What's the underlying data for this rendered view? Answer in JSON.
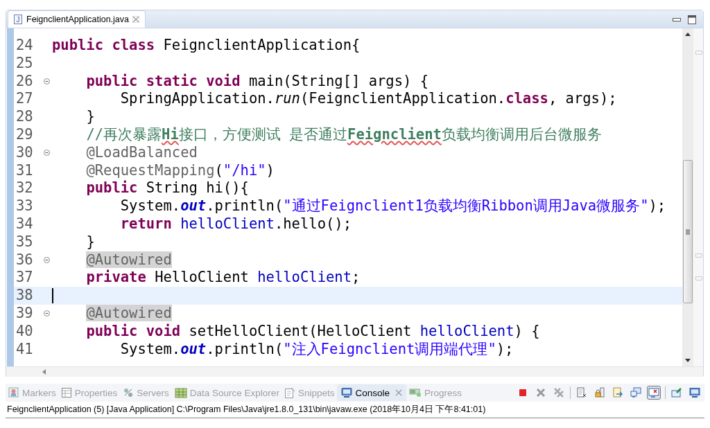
{
  "editor": {
    "tab": {
      "icon_text": "J",
      "title": "FeignclientApplication.java",
      "selected": true
    },
    "lines": [
      {
        "number": "24",
        "fold_marker": false,
        "current": false,
        "tokens": [
          {
            "kind": "kw",
            "text": "public class"
          },
          {
            "kind": "plain",
            "text": " FeignclientApplication{"
          }
        ]
      },
      {
        "number": "25",
        "fold_marker": false,
        "current": false
      },
      {
        "number": "26",
        "fold_marker": true,
        "current": false,
        "tokens": [
          {
            "kind": "kw",
            "text": "    public static void"
          },
          {
            "kind": "plain",
            "text": " main(String[] args) {"
          }
        ]
      },
      {
        "number": "27",
        "fold_marker": false,
        "current": false,
        "tokens": [
          {
            "kind": "plain",
            "text": "        SpringApplication."
          },
          {
            "kind": "static-method",
            "text": "run"
          },
          {
            "kind": "plain",
            "text": "(FeignclientApplication."
          },
          {
            "kind": "kw",
            "text": "class"
          },
          {
            "kind": "plain",
            "text": ", args);"
          }
        ]
      },
      {
        "number": "28",
        "fold_marker": false,
        "current": false,
        "tokens": [
          {
            "kind": "plain",
            "text": "    }"
          }
        ]
      },
      {
        "number": "29",
        "fold_marker": false,
        "current": false,
        "tokens": [
          {
            "kind": "comment",
            "text": "    //再次暴露"
          },
          {
            "kind": "comment-flagged",
            "text": "Hi"
          },
          {
            "kind": "comment",
            "text": "接口，方便测试 是否通过"
          },
          {
            "kind": "comment-flagged",
            "text": "Feignclient"
          },
          {
            "kind": "comment",
            "text": "负载均衡调用后台微服务"
          }
        ]
      },
      {
        "number": "30",
        "fold_marker": true,
        "current": false,
        "tokens": [
          {
            "kind": "ann",
            "text": "    @LoadBalanced"
          }
        ]
      },
      {
        "number": "31",
        "fold_marker": false,
        "current": false,
        "tokens": [
          {
            "kind": "ann",
            "text": "    @RequestMapping"
          },
          {
            "kind": "plain",
            "text": "("
          },
          {
            "kind": "str",
            "text": "\"/hi\""
          },
          {
            "kind": "plain",
            "text": ")"
          }
        ]
      },
      {
        "number": "32",
        "fold_marker": false,
        "current": false,
        "tokens": [
          {
            "kind": "kw",
            "text": "    public"
          },
          {
            "kind": "plain",
            "text": " String hi(){"
          }
        ]
      },
      {
        "number": "33",
        "fold_marker": false,
        "current": false,
        "tokens": [
          {
            "kind": "plain",
            "text": "        System."
          },
          {
            "kind": "static-field",
            "text": "out"
          },
          {
            "kind": "plain",
            "text": ".println("
          },
          {
            "kind": "str",
            "text": "\"通过Feignclient1负载均衡Ribbon调用Java微服务\""
          },
          {
            "kind": "plain",
            "text": ");"
          }
        ]
      },
      {
        "number": "34",
        "fold_marker": false,
        "current": false,
        "tokens": [
          {
            "kind": "kw",
            "text": "        return "
          },
          {
            "kind": "field",
            "text": "helloClient"
          },
          {
            "kind": "plain",
            "text": ".hello();"
          }
        ]
      },
      {
        "number": "35",
        "fold_marker": false,
        "current": false,
        "tokens": [
          {
            "kind": "plain",
            "text": "    }"
          }
        ]
      },
      {
        "number": "36",
        "fold_marker": true,
        "current": false,
        "tokens": [
          {
            "kind": "ann-marked",
            "text": "    @Autowired"
          }
        ]
      },
      {
        "number": "37",
        "fold_marker": false,
        "current": false,
        "tokens": [
          {
            "kind": "kw",
            "text": "    private"
          },
          {
            "kind": "plain",
            "text": " HelloClient "
          },
          {
            "kind": "field",
            "text": "helloClient"
          },
          {
            "kind": "plain",
            "text": ";"
          }
        ]
      },
      {
        "number": "38",
        "fold_marker": false,
        "current": true
      },
      {
        "number": "39",
        "fold_marker": true,
        "current": false,
        "tokens": [
          {
            "kind": "ann-marked",
            "text": "    @Autowired"
          }
        ]
      },
      {
        "number": "40",
        "fold_marker": false,
        "current": false,
        "tokens": [
          {
            "kind": "kw",
            "text": "    public void"
          },
          {
            "kind": "plain",
            "text": " setHelloClient(HelloClient "
          },
          {
            "kind": "field",
            "text": "helloClient"
          },
          {
            "kind": "plain",
            "text": ") {"
          }
        ]
      },
      {
        "number": "41",
        "fold_marker": false,
        "current": false,
        "tokens": [
          {
            "kind": "plain",
            "text": "        System."
          },
          {
            "kind": "static-field",
            "text": "out"
          },
          {
            "kind": "plain",
            "text": ".println("
          },
          {
            "kind": "str",
            "text": "\"注入Feignclient调用端代理\""
          },
          {
            "kind": "plain",
            "text": ");"
          }
        ]
      }
    ]
  },
  "bottom_panel": {
    "tabs": [
      {
        "label": "Markers",
        "selected": false
      },
      {
        "label": "Properties",
        "selected": false
      },
      {
        "label": "Servers",
        "selected": false
      },
      {
        "label": "Data Source Explorer",
        "selected": false
      },
      {
        "label": "Snippets",
        "selected": false
      },
      {
        "label": "Console",
        "selected": true
      },
      {
        "label": "Progress",
        "selected": false
      }
    ],
    "toolbar": [
      {
        "pressed": false
      },
      {
        "pressed": false
      },
      {
        "pressed": false
      },
      {
        "pressed": false
      },
      {
        "pressed": false
      },
      {
        "pressed": false
      },
      {
        "pressed": false
      },
      {
        "pressed": true
      },
      {
        "pressed": false
      },
      {
        "pressed": false
      }
    ],
    "console_title": "FeignclientApplication (5) [Java Application] C:\\Program Files\\Java\\jre1.8.0_131\\bin\\javaw.exe (2018年10月4日 下午8:41:01)"
  }
}
